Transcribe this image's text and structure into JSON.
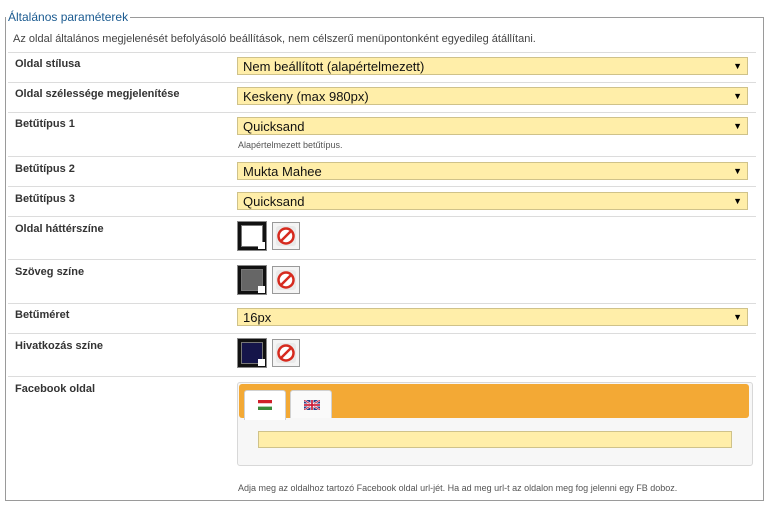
{
  "legend": "Általános paraméterek",
  "description": "Az oldal általános megjelenését befolyásoló beállítások, nem célszerű menüpontonként egyedileg átállítani.",
  "rows": {
    "page_style": {
      "label": "Oldal stílusa",
      "value": "Nem beállított (alapértelmezett)"
    },
    "page_width": {
      "label": "Oldal szélessége megjelenítése",
      "value": "Keskeny (max 980px)"
    },
    "font1": {
      "label": "Betűtípus 1",
      "value": "Quicksand",
      "hint": "Alapértelmezett betűtípus."
    },
    "font2": {
      "label": "Betűtípus 2",
      "value": "Mukta Mahee"
    },
    "font3": {
      "label": "Betűtípus 3",
      "value": "Quicksand"
    },
    "bg_color": {
      "label": "Oldal háttérszíne",
      "color": "#ffffff"
    },
    "text_color": {
      "label": "Szöveg színe",
      "color": "#666666"
    },
    "font_size": {
      "label": "Betűméret",
      "value": "16px"
    },
    "link_color": {
      "label": "Hivatkozás színe",
      "color": "#15154a"
    },
    "facebook": {
      "label": "Facebook oldal",
      "value": "",
      "hint": "Adja meg az oldalhoz tartozó Facebook oldal url-jét. Ha ad meg url-t az oldalon meg fog jelenni egy FB doboz."
    }
  },
  "icons": {
    "dropdown": "▼",
    "clear": "clear-color-icon",
    "flag_hu": "hungarian-flag-icon",
    "flag_en": "uk-flag-icon"
  },
  "colors": {
    "accent": "#f3a935",
    "field": "#ffeea9",
    "legend": "#1a5a90"
  }
}
